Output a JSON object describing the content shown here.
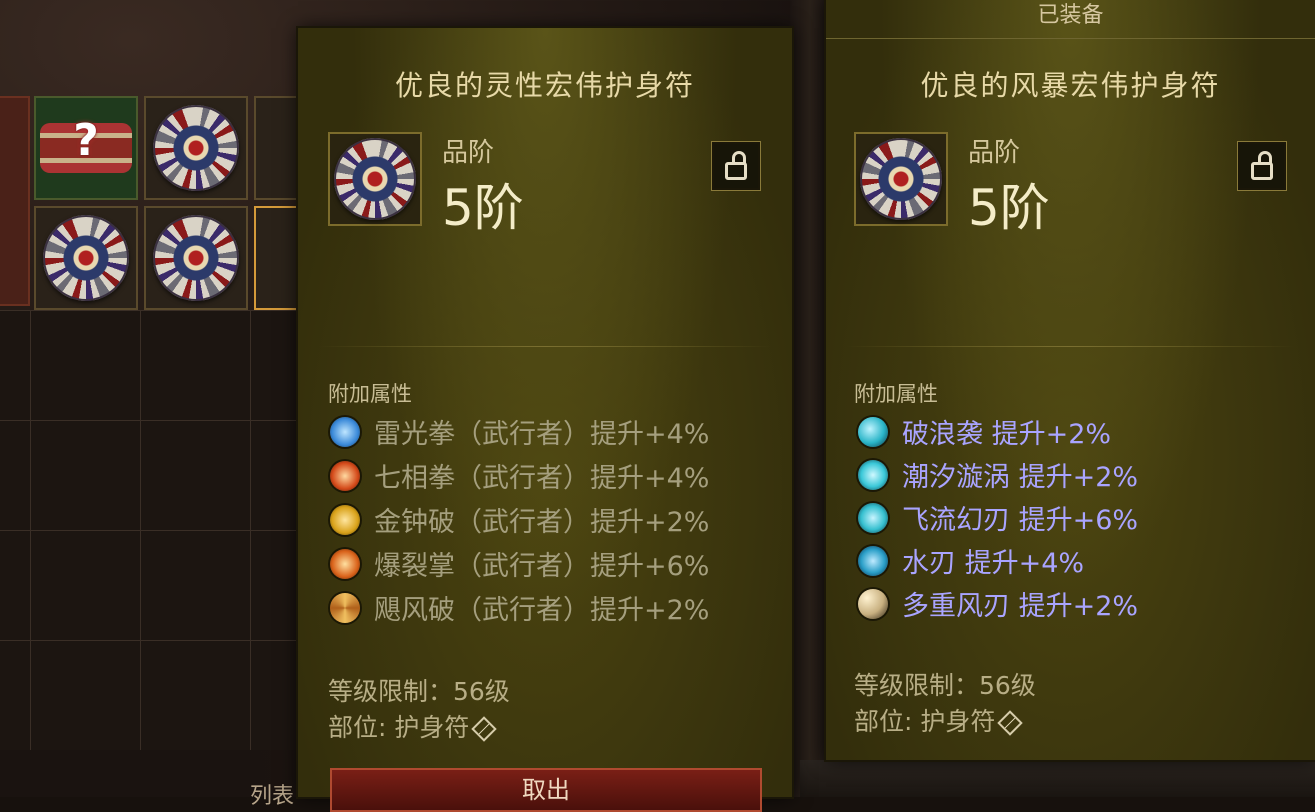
{
  "background": {
    "bottom_text": "列表"
  },
  "left_tooltip": {
    "title": "优良的灵性宏伟护身符",
    "rank_label": "品阶",
    "rank_value": "5阶",
    "affix_section_label": "附加属性",
    "affixes": [
      {
        "name": "雷光拳（武行者）提升+4%",
        "icon": "lightning-fist-icon",
        "color": "#3b8ad9"
      },
      {
        "name": "七相拳（武行者）提升+4%",
        "icon": "seven-sided-strike-icon",
        "color": "#d44a1a"
      },
      {
        "name": "金钟破（武行者）提升+2%",
        "icon": "wave-of-light-icon",
        "color": "#d9a21a"
      },
      {
        "name": "爆裂掌（武行者）提升+6%",
        "icon": "exploding-palm-icon",
        "color": "#d9621a"
      },
      {
        "name": "飓风破（武行者）提升+2%",
        "icon": "cyclone-strike-icon",
        "color": "#e0902a"
      }
    ],
    "level_req": "等级限制：56级",
    "slot": "部位: 护身符",
    "action_button": "取出"
  },
  "right_tooltip": {
    "equipped_label": "已装备",
    "title": "优良的风暴宏伟护身符",
    "rank_label": "品阶",
    "rank_value": "5阶",
    "affix_section_label": "附加属性",
    "affixes": [
      {
        "name": "破浪袭  提升+2%",
        "icon": "wave-strike-icon",
        "color": "#2ab5c8"
      },
      {
        "name": "潮汐漩涡  提升+2%",
        "icon": "tidal-vortex-icon",
        "color": "#3ac8d8"
      },
      {
        "name": "飞流幻刃  提升+6%",
        "icon": "flowing-blade-icon",
        "color": "#36c0d0"
      },
      {
        "name": "水刃  提升+4%",
        "icon": "water-blade-icon",
        "color": "#2a9fc8"
      },
      {
        "name": "多重风刃  提升+2%",
        "icon": "multi-wind-blade-icon",
        "color": "#c8b080"
      }
    ],
    "level_req": "等级限制：56级",
    "slot": "部位: 护身符"
  }
}
